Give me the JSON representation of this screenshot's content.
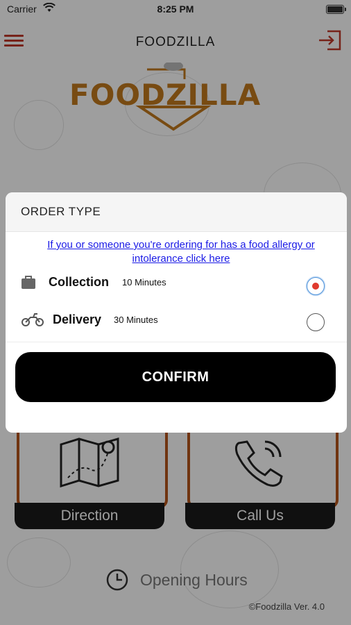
{
  "status_bar": {
    "carrier": "Carrier",
    "time": "8:25 PM"
  },
  "nav": {
    "title": "FOODZILLA"
  },
  "logo": {
    "text": "FOODZILLA"
  },
  "cards": [
    {
      "label": "Direction",
      "icon": "map-icon"
    },
    {
      "label": "Call Us",
      "icon": "phone-icon"
    }
  ],
  "opening_hours": {
    "label": "Opening Hours",
    "icon": "clock-icon"
  },
  "version": "©Foodzilla Ver. 4.0",
  "modal": {
    "title": "ORDER TYPE",
    "allergy_link": "If you or someone you're ordering for has a food allergy or intolerance click here",
    "options": [
      {
        "name": "Collection",
        "time": "10 Minutes",
        "icon": "bag-icon",
        "selected": true
      },
      {
        "name": "Delivery",
        "time": "30 Minutes",
        "icon": "scooter-icon",
        "selected": false
      }
    ],
    "confirm_label": "CONFIRM"
  },
  "colors": {
    "accent": "#c0392b",
    "brand": "#c27a1e",
    "card_border": "#b5541a",
    "radio_selected": "#e03a2e",
    "link": "#1a1ae6"
  }
}
